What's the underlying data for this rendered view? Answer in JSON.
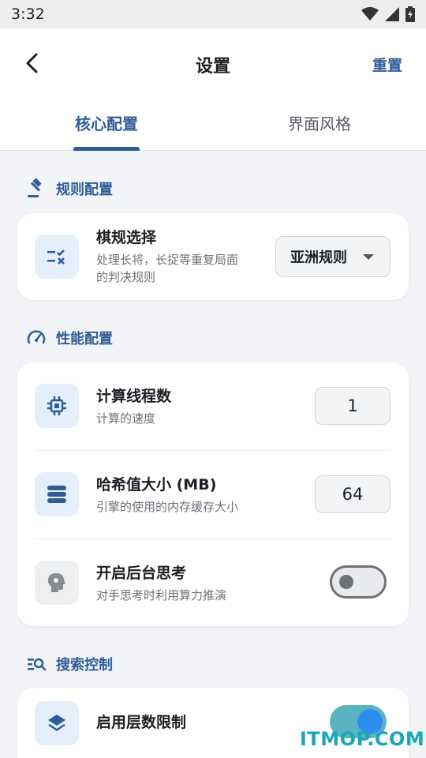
{
  "status_bar": {
    "time": "3:32"
  },
  "header": {
    "title": "设置",
    "reset_label": "重置"
  },
  "tabs": [
    {
      "label": "核心配置",
      "selected": true
    },
    {
      "label": "界面风格",
      "selected": false
    }
  ],
  "sections": {
    "rules": {
      "title": "规则配置",
      "rows": {
        "rule_select": {
          "label": "棋规选择",
          "desc_line1": "处理长将，长捉等重复局面",
          "desc_line2": "的判决规则",
          "value": "亚洲规则"
        }
      }
    },
    "performance": {
      "title": "性能配置",
      "rows": {
        "threads": {
          "label": "计算线程数",
          "desc": "计算的速度",
          "value": "1"
        },
        "hash": {
          "label": "哈希值大小 (MB)",
          "desc": "引擎的使用的内存缓存大小",
          "value": "64"
        },
        "ponder": {
          "label": "开启后台思考",
          "desc": "对手思考时利用算力推演",
          "enabled": false
        }
      }
    },
    "search": {
      "title": "搜索控制",
      "rows": {
        "depth_limit": {
          "label": "启用层数限制",
          "enabled": true
        }
      }
    }
  },
  "watermark": "ITMOP.COM",
  "colors": {
    "accent": "#2f5d97",
    "switch_on_track": "#5bb3c2",
    "switch_on_knob": "#2e8ef0",
    "background": "#f2f4f8"
  }
}
